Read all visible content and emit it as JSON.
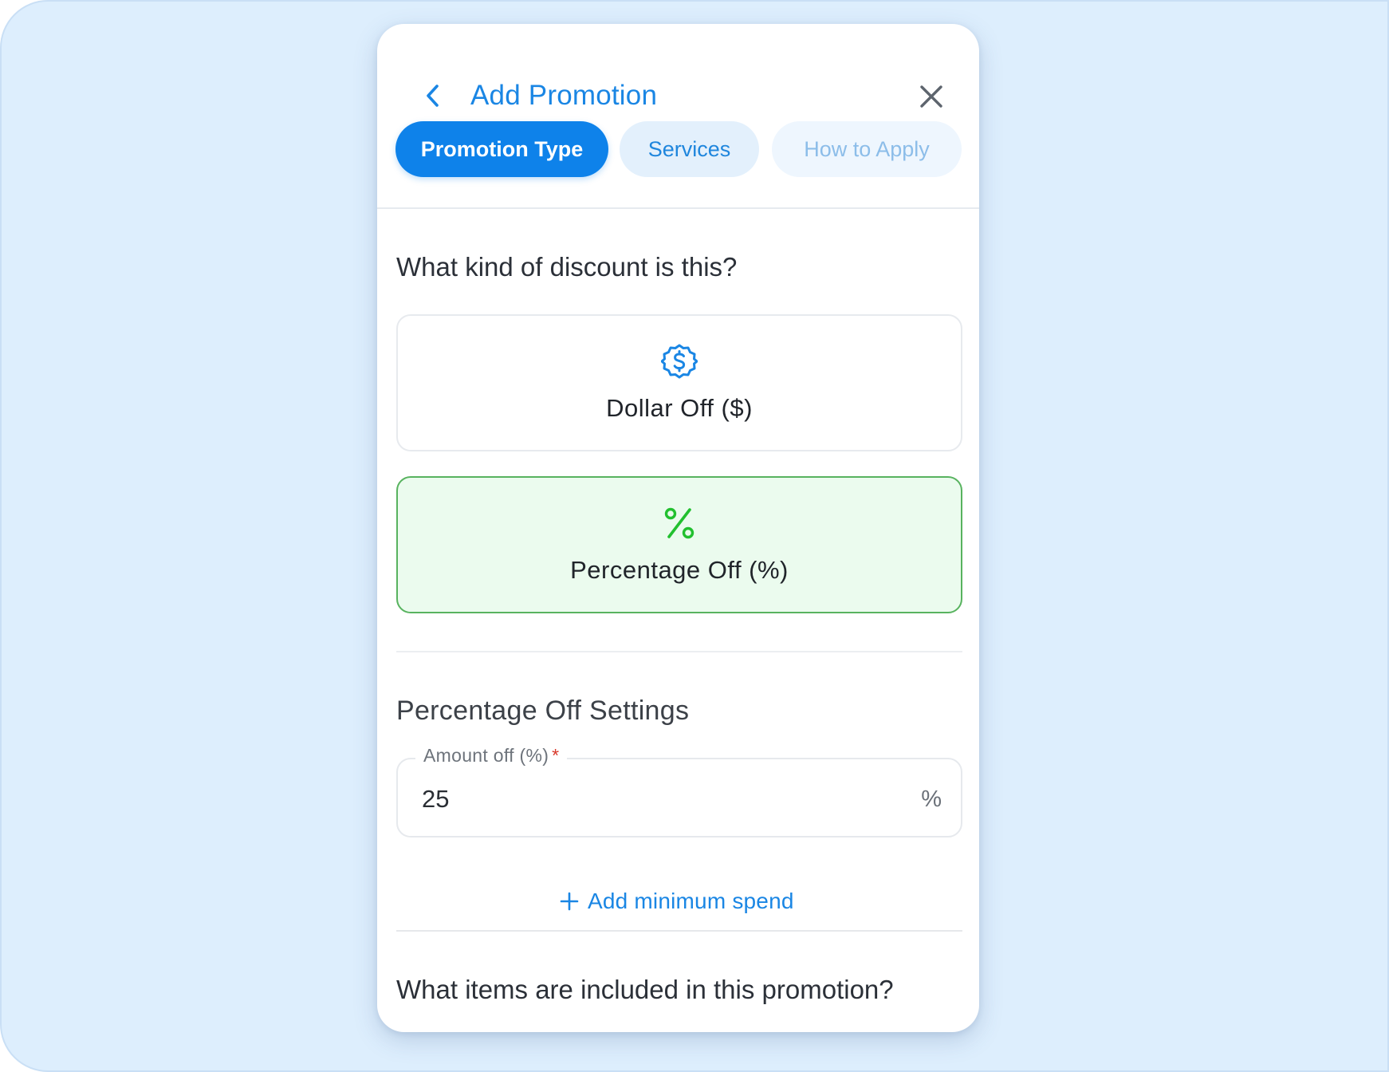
{
  "modal": {
    "title": "Add Promotion"
  },
  "tabs": [
    {
      "label": "Promotion Type",
      "state": "active"
    },
    {
      "label": "Services",
      "state": "enabled"
    },
    {
      "label": "How to Apply",
      "state": "disabled"
    }
  ],
  "discount": {
    "question": "What kind of discount is this?",
    "options": [
      {
        "label": "Dollar Off ($)",
        "icon": "dollar-badge-icon",
        "selected": false
      },
      {
        "label": "Percentage Off (%)",
        "icon": "percent-icon",
        "selected": true
      }
    ]
  },
  "settings": {
    "title": "Percentage Off Settings",
    "amount_label": "Amount off (%)",
    "required_mark": "*",
    "amount_value": "25",
    "amount_suffix": "%",
    "add_minimum_label": "Add minimum spend"
  },
  "items": {
    "question": "What items are included in this promotion?"
  },
  "colors": {
    "accent": "#0e82ea",
    "selected_bg": "#ebfbee",
    "selected_border": "#58b35f",
    "percent_icon": "#22c02f",
    "backdrop": "#ddeefd"
  }
}
